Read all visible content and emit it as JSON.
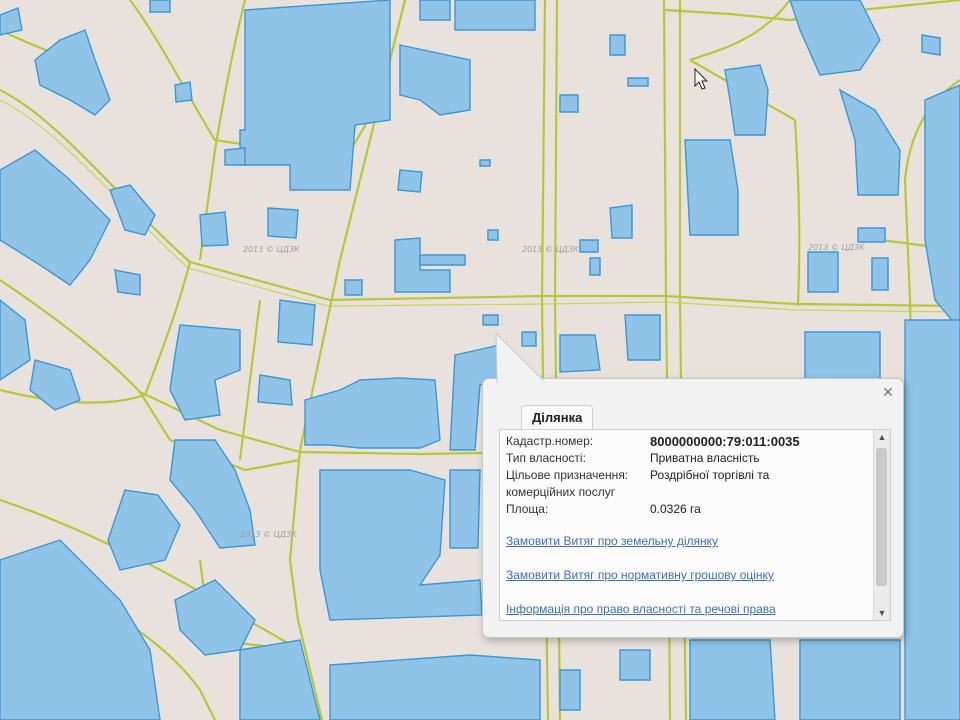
{
  "map": {
    "watermarks": [
      "2013 © ЦДЗК",
      "2013 © ЦДЗК",
      "2013 © ЦДЗК",
      "2013 © ЦДЗК"
    ],
    "colors": {
      "background": "#e9e2dc",
      "road": "#b4c83a",
      "building_fill": "#8fc3e8",
      "building_stroke": "#3d97d3"
    }
  },
  "popup": {
    "tab_label": "Ділянка",
    "close_icon": "close-icon",
    "fields": [
      {
        "key": "Кадастр.номер:",
        "value": "8000000000:79:011:0035"
      },
      {
        "key": "Тип власності:",
        "value": "Приватна власність"
      },
      {
        "key": "Цільове призначення:",
        "value": "Роздрібної торгівлі та"
      },
      {
        "key": "комерційних послуг",
        "value": ""
      },
      {
        "key": "Площа:",
        "value": "0.0326 га"
      }
    ],
    "links": [
      "Замовити Витяг про земельну ділянку",
      "Замовити Витяг про нормативну грошову оцінку",
      "Інформація про право власності та речові права"
    ]
  }
}
